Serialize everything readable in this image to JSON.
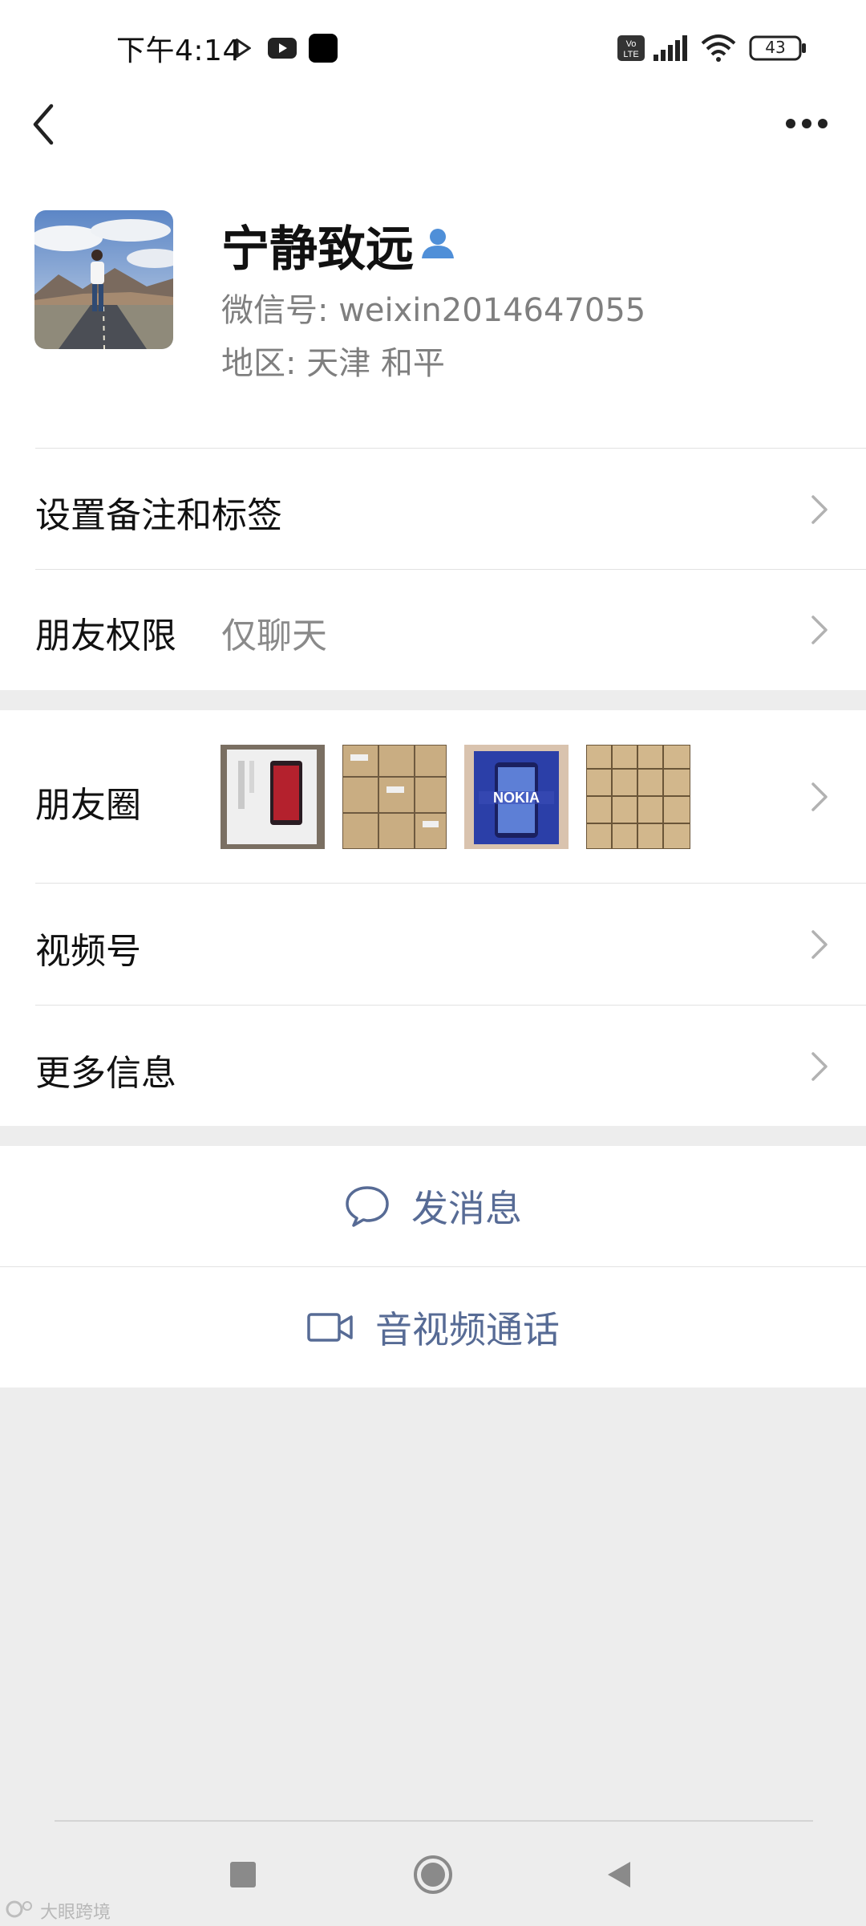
{
  "status_bar": {
    "time": "下午4:14",
    "battery": "43"
  },
  "profile": {
    "name": "宁静致远",
    "wechat_id": "微信号: weixin2014647055",
    "region": "地区: 天津  和平"
  },
  "rows": {
    "remark": {
      "label": "设置备注和标签"
    },
    "permission": {
      "label": "朋友权限",
      "value": "仅聊天"
    },
    "moments": {
      "label": "朋友圈"
    },
    "channels": {
      "label": "视频号"
    },
    "more_info": {
      "label": "更多信息"
    }
  },
  "actions": {
    "message": "发消息",
    "call": "音视频通话"
  },
  "watermark": "大眼跨境",
  "colors": {
    "link_blue": "#576b95",
    "background": "#ededed",
    "secondary_text": "#7f7f7f"
  }
}
